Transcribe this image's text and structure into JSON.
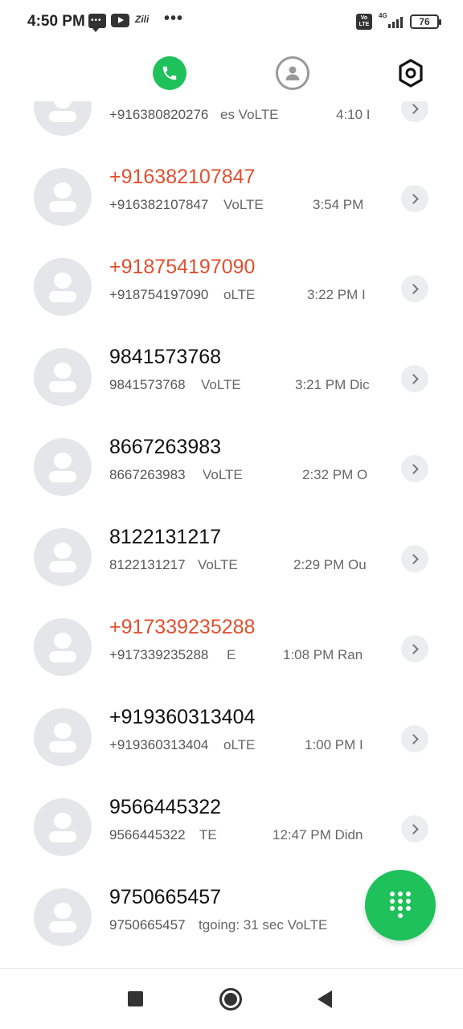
{
  "status_bar": {
    "time": "4:50 PM",
    "app_badge_text": "Zili",
    "overflow": "•••",
    "volte_badge": "Vo LTE",
    "network": "4G",
    "battery": "76"
  },
  "tabs": [
    {
      "name": "phone",
      "icon": "phone-icon",
      "active": true,
      "color": "#1ec15a"
    },
    {
      "name": "contacts",
      "icon": "contact-icon",
      "active": false
    },
    {
      "name": "settings",
      "icon": "settings-icon",
      "active": false
    }
  ],
  "colors": {
    "accent": "#1ec15a",
    "missed": "#e0502f"
  },
  "calls": [
    {
      "name": "",
      "number": "+916380820276",
      "extra": "es VoLTE",
      "time": "4:10 I",
      "missed": false
    },
    {
      "name": "+916382107847",
      "number": "+916382107847",
      "extra": "VoLTE",
      "time": "3:54 PM",
      "missed": true
    },
    {
      "name": "+918754197090",
      "number": "+918754197090",
      "extra": "oLTE",
      "time": "3:22 PM I",
      "missed": true
    },
    {
      "name": "9841573768",
      "number": "9841573768",
      "extra": "VoLTE",
      "time": "3:21 PM Dic",
      "missed": false
    },
    {
      "name": "8667263983",
      "number": "8667263983",
      "extra": "VoLTE",
      "time": "2:32 PM O",
      "missed": false
    },
    {
      "name": "8122131217",
      "number": "8122131217",
      "extra": "VoLTE",
      "time": "2:29 PM Ou",
      "missed": false
    },
    {
      "name": "+917339235288",
      "number": "+917339235288",
      "extra": "E",
      "time": "1:08 PM Ran",
      "missed": true
    },
    {
      "name": "+919360313404",
      "number": "+919360313404",
      "extra": "oLTE",
      "time": "1:00 PM I",
      "missed": false
    },
    {
      "name": "9566445322",
      "number": "9566445322",
      "extra": "TE",
      "time": "12:47 PM Didn",
      "missed": false
    },
    {
      "name": "9750665457",
      "number": "9750665457",
      "extra": "tgoing: 31 sec VoLTE",
      "time": "",
      "missed": false
    }
  ],
  "fab": {
    "icon": "dialpad-icon"
  },
  "nav": {
    "recents": "square-icon",
    "home": "home-circle-icon",
    "back": "back-triangle-icon"
  }
}
